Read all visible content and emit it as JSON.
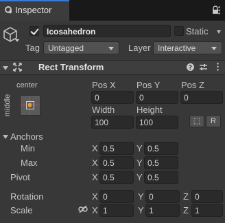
{
  "tab": {
    "title": "Inspector",
    "icon": "info-icon"
  },
  "header": {
    "name": "Icosahedron",
    "active_checked": true,
    "static_label": "Static",
    "static_checked": false,
    "tag_label": "Tag",
    "tag_value": "Untagged",
    "layer_label": "Layer",
    "layer_value": "Interactive"
  },
  "component": {
    "title": "Rect Transform",
    "icons": [
      "help-icon",
      "settings-sliders-icon",
      "kebab-menu-icon"
    ],
    "preset_top": "center",
    "preset_side": "middle",
    "columns": [
      "Pos X",
      "Pos Y",
      "Pos Z"
    ],
    "pos": [
      "0",
      "0",
      "0"
    ],
    "size_labels": [
      "Width",
      "Height"
    ],
    "size": [
      "100",
      "100"
    ],
    "blueprint_button": "⬚",
    "raw_button": "R"
  },
  "anchors": {
    "label": "Anchors",
    "min_label": "Min",
    "min": {
      "x": "0.5",
      "y": "0.5"
    },
    "max_label": "Max",
    "max": {
      "x": "0.5",
      "y": "0.5"
    }
  },
  "pivot": {
    "label": "Pivot",
    "x": "0.5",
    "y": "0.5"
  },
  "rotation": {
    "label": "Rotation",
    "x": "0",
    "y": "0",
    "z": "0"
  },
  "scale": {
    "label": "Scale",
    "x": "1",
    "y": "1",
    "z": "1"
  },
  "axis": {
    "x": "X",
    "y": "Y",
    "z": "Z"
  },
  "colors": {
    "accent": "#3a7bd5",
    "background": "#383838",
    "field": "#2a2a2a"
  }
}
